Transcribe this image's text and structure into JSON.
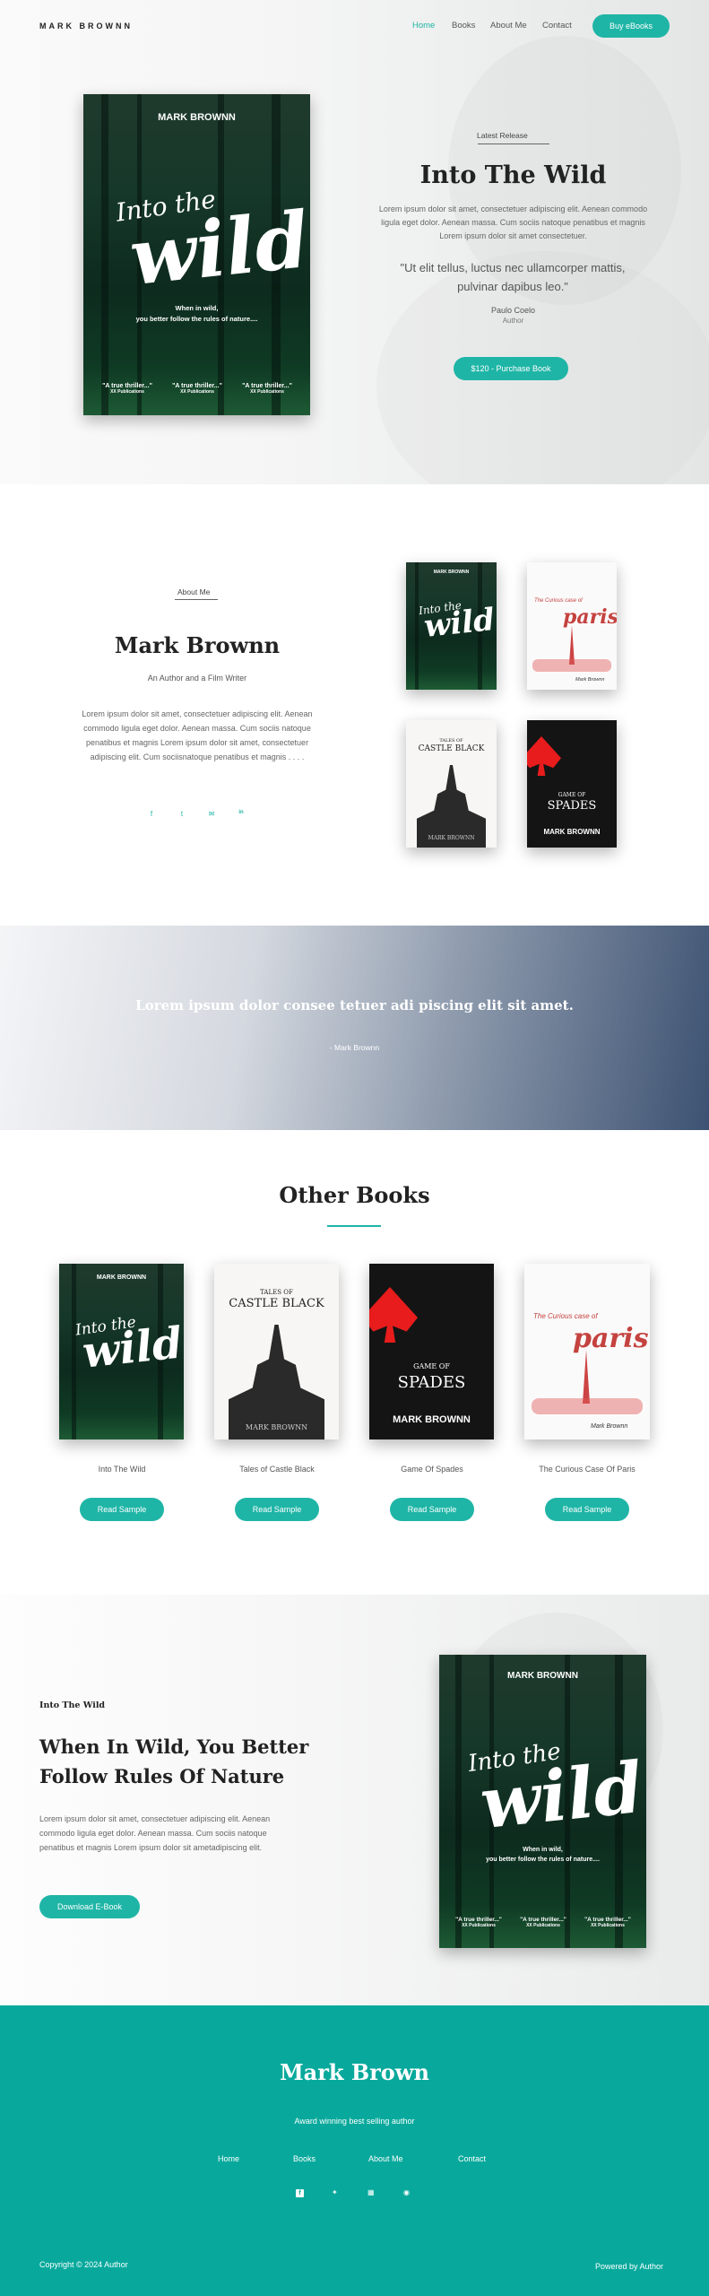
{
  "header": {
    "logo": "MARK BROWNN",
    "nav": [
      "Home",
      "Books",
      "About Me",
      "Contact"
    ],
    "cta": "Buy eBooks"
  },
  "hero": {
    "kicker": "Latest Release",
    "title": "Into The Wild",
    "text": "Lorem ipsum dolor sit amet, consectetuer adipiscing elit. Aenean commodo ligula eget dolor. Aenean massa. Cum sociis natoque penatibus et magnis Lorem ipsum dolor sit amet consectetuer.",
    "quote": "\"Ut elit tellus, luctus nec ullamcorper mattis, pulvinar dapibus leo.\"",
    "quote_author": "Paulo Coelo",
    "quote_role": "Author",
    "button": "$120 - Purchase Book"
  },
  "covers": {
    "wild": {
      "author": "MARK BROWNN",
      "into": "Into the",
      "big": "wild",
      "tagline1": "When in wild,",
      "tagline2": "you better follow the rules of nature....",
      "blurb": "\"A true thriller...\"",
      "blurb_src": "XX Publications"
    },
    "paris": {
      "title1": "The Curious case of",
      "title2": "paris",
      "author": "Mark Brownn"
    },
    "castle": {
      "kicker": "TALES OF",
      "title": "CASTLE BLACK",
      "author": "MARK BROWNN"
    },
    "spades": {
      "title1": "GAME OF",
      "title2": "SPADES",
      "author": "MARK BROWNN"
    }
  },
  "about": {
    "kicker": "About Me",
    "name": "Mark Brownn",
    "role": "An Author and a Film Writer",
    "text": "Lorem ipsum dolor sit amet, consectetuer adipiscing elit. Aenean commodo ligula eget dolor. Aenean massa. Cum sociis natoque penatibus et magnis Lorem ipsum dolor sit amet, consectetuer adipiscing elit. Cum sociisnatoque penatibus et magnis . . . .",
    "social": [
      "f",
      "t",
      "✉",
      "in"
    ]
  },
  "band": {
    "quote": "Lorem ipsum dolor consee tetuer adi piscing elit sit amet.",
    "author": "- Mark Brownn"
  },
  "other": {
    "title": "Other Books",
    "books": [
      {
        "name": "Into The Wild",
        "button": "Read Sample"
      },
      {
        "name": "Tales of Castle Black",
        "button": "Read Sample"
      },
      {
        "name": "Game Of Spades",
        "button": "Read Sample"
      },
      {
        "name": "The Curious Case Of Paris",
        "button": "Read Sample"
      }
    ]
  },
  "promo": {
    "kicker": "Into The Wild",
    "title1": "When In Wild, You Better",
    "title2": "Follow Rules Of Nature",
    "text": "Lorem ipsum dolor sit amet, consectetuer adipiscing elit. Aenean commodo ligula eget dolor. Aenean massa. Cum sociis natoque penatibus et magnis Lorem ipsum dolor sit ametadipiscing elit.",
    "button": "Download E-Book"
  },
  "footer": {
    "name": "Mark Brown",
    "tagline": "Award winning best selling author",
    "nav": [
      "Home",
      "Books",
      "About Me",
      "Contact"
    ],
    "copyright": "Copyright © 2024 Author",
    "powered": "Powered by Author"
  },
  "colors": {
    "accent": "#1fb5a6",
    "footer": "#08a99c"
  }
}
